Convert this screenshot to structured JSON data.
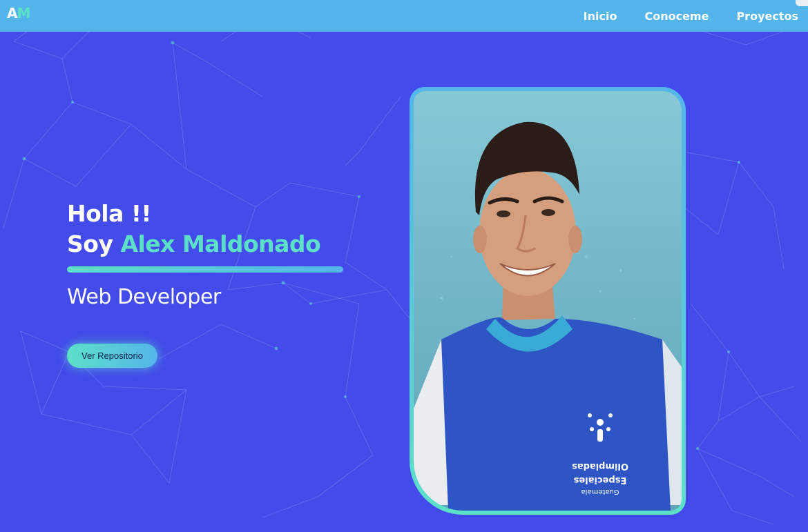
{
  "nav": {
    "logo_a": "A",
    "logo_m": "M",
    "links": [
      "Inicio",
      "Conoceme",
      "Proyectos"
    ]
  },
  "hero": {
    "greeting": "Hola !!",
    "name_prefix": "Soy",
    "name": "Alex Maldonado",
    "role": "Web Developer",
    "button_label": "Ver Repositorio"
  },
  "photo": {
    "shirt_text_line1": "Olimpiadas",
    "shirt_text_line2": "Especiales",
    "shirt_text_line3": "Guatemala"
  },
  "colors": {
    "background": "#434bea",
    "navbar": "#54b5ea",
    "accent": "#5ce0c8"
  }
}
